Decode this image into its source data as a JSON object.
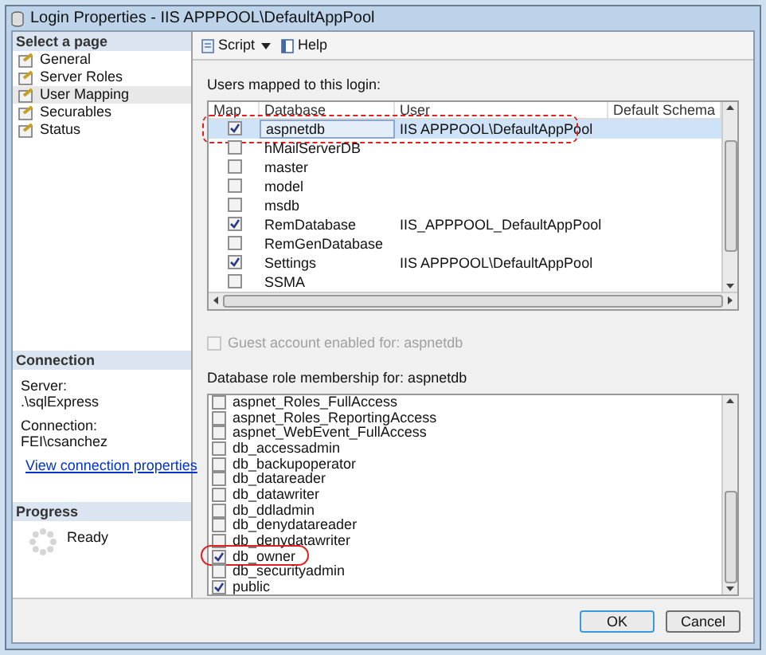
{
  "window": {
    "title": "Login Properties - IIS APPPOOL\\DefaultAppPool"
  },
  "sidebar": {
    "heading": "Select a page",
    "items": [
      {
        "label": "General",
        "selected": false
      },
      {
        "label": "Server Roles",
        "selected": false
      },
      {
        "label": "User Mapping",
        "selected": true
      },
      {
        "label": "Securables",
        "selected": false
      },
      {
        "label": "Status",
        "selected": false
      }
    ]
  },
  "toolbar": {
    "script": "Script",
    "help": "Help"
  },
  "mapping": {
    "label": "Users mapped to this login:",
    "columns": [
      "Map",
      "Database",
      "User",
      "Default Schema"
    ],
    "rows": [
      {
        "checked": true,
        "database": "aspnetdb",
        "user": "IIS APPPOOL\\DefaultAppPool",
        "selected": true,
        "annotated": true
      },
      {
        "checked": false,
        "database": "hMailServerDB",
        "selected": false,
        "annotated": false
      },
      {
        "checked": false,
        "database": "master",
        "selected": false,
        "annotated": false
      },
      {
        "checked": false,
        "database": "model",
        "selected": false,
        "annotated": false
      },
      {
        "checked": false,
        "database": "msdb",
        "selected": false,
        "annotated": false
      },
      {
        "checked": true,
        "database": "RemDatabase",
        "user": "IIS_APPPOOL_DefaultAppPool",
        "selected": false,
        "annotated": false
      },
      {
        "checked": false,
        "database": "RemGenDatabase",
        "selected": false,
        "annotated": false
      },
      {
        "checked": true,
        "database": "Settings",
        "user": "IIS APPPOOL\\DefaultAppPool",
        "selected": false,
        "annotated": false
      },
      {
        "checked": false,
        "database": "SSMA",
        "selected": false,
        "annotated": false
      }
    ]
  },
  "guest": {
    "label": "Guest account enabled for: aspnetdb",
    "checked": false,
    "disabled": true
  },
  "roles": {
    "label": "Database role membership for: aspnetdb",
    "items": [
      {
        "name": "aspnet_Roles_FullAccess",
        "checked": false,
        "annotated": false
      },
      {
        "name": "aspnet_Roles_ReportingAccess",
        "checked": false,
        "annotated": false
      },
      {
        "name": "aspnet_WebEvent_FullAccess",
        "checked": false,
        "annotated": false
      },
      {
        "name": "db_accessadmin",
        "checked": false,
        "annotated": false
      },
      {
        "name": "db_backupoperator",
        "checked": false,
        "annotated": false
      },
      {
        "name": "db_datareader",
        "checked": false,
        "annotated": false
      },
      {
        "name": "db_datawriter",
        "checked": false,
        "annotated": false
      },
      {
        "name": "db_ddladmin",
        "checked": false,
        "annotated": false
      },
      {
        "name": "db_denydatareader",
        "checked": false,
        "annotated": false
      },
      {
        "name": "db_denydatawriter",
        "checked": false,
        "annotated": false
      },
      {
        "name": "db_owner",
        "checked": true,
        "annotated": true
      },
      {
        "name": "db_securityadmin",
        "checked": false,
        "annotated": false
      },
      {
        "name": "public",
        "checked": true,
        "annotated": false
      }
    ]
  },
  "connection": {
    "heading": "Connection",
    "server_label": "Server:",
    "server": ".\\sqlExpress",
    "connection_label": "Connection:",
    "connection": "FEI\\csanchez",
    "link": "View connection properties"
  },
  "progress": {
    "heading": "Progress",
    "status": "Ready"
  },
  "buttons": [
    "OK",
    "Cancel"
  ]
}
